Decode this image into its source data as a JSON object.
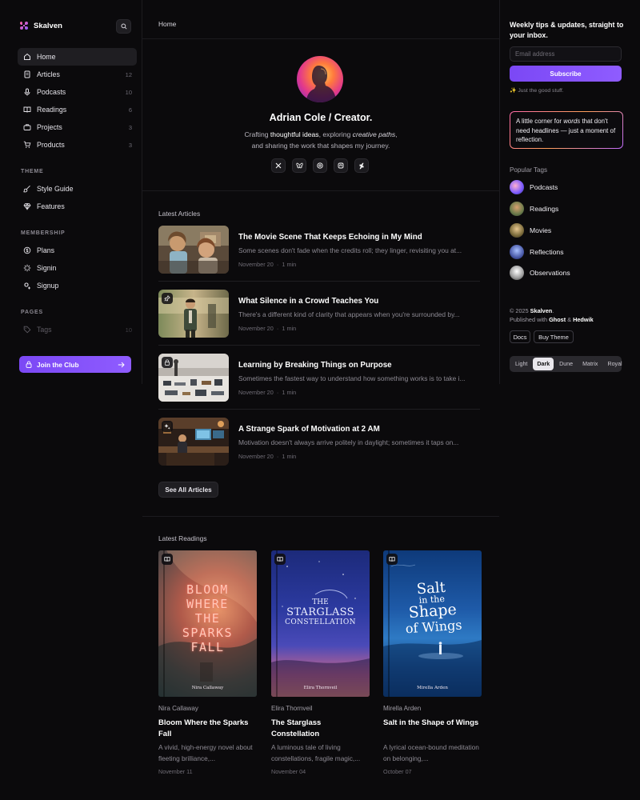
{
  "brand": {
    "name": "Skalven"
  },
  "nav": {
    "main": [
      {
        "label": "Home",
        "icon": "home-icon",
        "count": ""
      },
      {
        "label": "Articles",
        "icon": "document-icon",
        "count": "12"
      },
      {
        "label": "Podcasts",
        "icon": "mic-icon",
        "count": "10"
      },
      {
        "label": "Readings",
        "icon": "book-icon",
        "count": "6"
      },
      {
        "label": "Projects",
        "icon": "briefcase-icon",
        "count": "3"
      },
      {
        "label": "Products",
        "icon": "cart-icon",
        "count": "3"
      }
    ],
    "theme_heading": "THEME",
    "theme": [
      {
        "label": "Style Guide",
        "icon": "brush-icon"
      },
      {
        "label": "Features",
        "icon": "diamond-icon"
      }
    ],
    "membership_heading": "MEMBERSHIP",
    "membership": [
      {
        "label": "Plans",
        "icon": "coin-icon"
      },
      {
        "label": "Signin",
        "icon": "spark-icon"
      },
      {
        "label": "Signup",
        "icon": "spark-plus-icon"
      }
    ],
    "pages_heading": "PAGES",
    "pages": [
      {
        "label": "Tags",
        "icon": "tag-icon",
        "count": "10"
      }
    ],
    "join_label": "Join the Club"
  },
  "breadcrumb": "Home",
  "hero": {
    "name": "Adrian Cole / Creator.",
    "bio_1a": "Crafting ",
    "bio_1b": "thoughtful ideas",
    "bio_1c": ", exploring ",
    "bio_1d": "creative paths",
    "bio_1e": ",",
    "bio_2": "and sharing the work that shapes my journey.",
    "socials": [
      "X",
      "Bluesky",
      "Threads",
      "Mastodon",
      "Deviantart"
    ]
  },
  "articles": {
    "heading": "Latest Articles",
    "items": [
      {
        "title": "The Movie Scene That Keeps Echoing in My Mind",
        "excerpt": "Some scenes don't fade when the credits roll; they linger, revisiting you at...",
        "date": "November 20",
        "read": "1 min",
        "badge": ""
      },
      {
        "title": "What Silence in a Crowd Teaches You",
        "excerpt": "There's a different kind of clarity that appears when you're surrounded by...",
        "date": "November 20",
        "read": "1 min",
        "badge": "pin-icon"
      },
      {
        "title": "Learning by Breaking Things on Purpose",
        "excerpt": "Sometimes the fastest way to understand how something works is to take i...",
        "date": "November 20",
        "read": "1 min",
        "badge": "lock-icon"
      },
      {
        "title": "A Strange Spark of Motivation at 2 AM",
        "excerpt": "Motivation doesn't always arrive politely in daylight; sometimes it taps on...",
        "date": "November 20",
        "read": "1 min",
        "badge": "sparkle-icon"
      }
    ],
    "see_all": "See All Articles"
  },
  "readings": {
    "heading": "Latest Readings",
    "items": [
      {
        "author": "Nira Callaway",
        "title": "Bloom Where the Sparks Fall",
        "desc": "A vivid, high-energy novel about fleeting brilliance,...",
        "date": "November 11",
        "cover_lines": [
          "BLOOM",
          "WHERE",
          "THE",
          "SPARKS",
          "FALL"
        ],
        "cover_author": "Nira Callaway"
      },
      {
        "author": "Elira Thornveil",
        "title": "The Starglass Constellation",
        "desc": "A luminous tale of living constellations, fragile magic,...",
        "date": "November 04",
        "cover_lines": [
          "THE",
          "STARGLASS",
          "CONSTELLATION"
        ],
        "cover_author": "Elira Thornveil"
      },
      {
        "author": "Mirella Arden",
        "title": "Salt in the Shape of Wings",
        "desc": "A lyrical ocean-bound meditation on belonging,...",
        "date": "October 07",
        "cover_lines": [
          "Salt",
          "in the",
          "Shape",
          "of Wings"
        ],
        "cover_author": "Mirella Arden"
      }
    ]
  },
  "newsletter": {
    "title": "Weekly tips & updates, straight to your inbox.",
    "placeholder": "Email address",
    "button": "Subscribe",
    "note": "✨ Just the good stuff."
  },
  "quote": {
    "a": "A little corner for ",
    "b": "words",
    "c": " that don't need headlines — just a moment of reflection."
  },
  "tags": {
    "heading": "Popular Tags",
    "items": [
      "Podcasts",
      "Readings",
      "Movies",
      "Reflections",
      "Observations"
    ]
  },
  "footer": {
    "copy_a": "© 2025 ",
    "copy_b": "Skalven",
    "copy_c": ".",
    "pub_a": "Published with ",
    "pub_b": "Ghost",
    "pub_c": " & ",
    "pub_d": "Hedwik",
    "docs": "Docs",
    "buy": "Buy Theme",
    "themes": [
      "Light",
      "Dark",
      "Dune",
      "Matrix",
      "Royal"
    ],
    "active_theme": "Dark"
  },
  "colors": {
    "accent": "#7b48f5",
    "background": "#0b0a0c"
  }
}
